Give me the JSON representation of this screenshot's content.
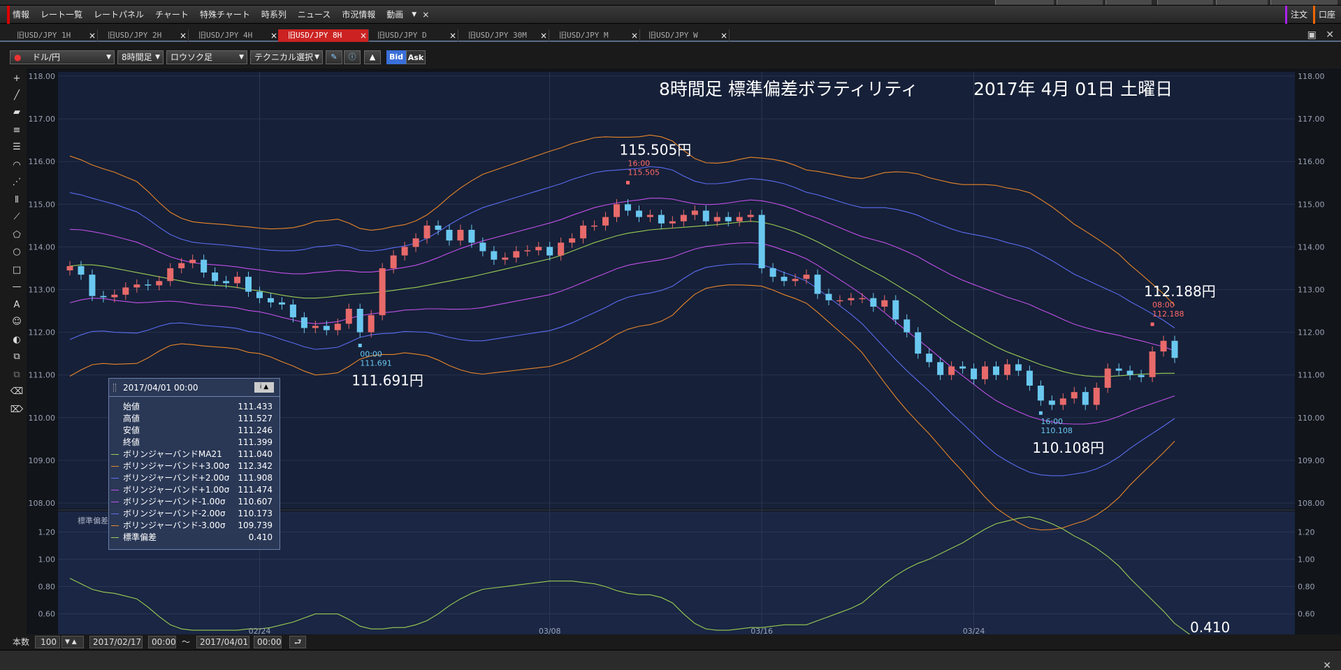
{
  "menu": {
    "items": [
      "情報",
      "レート一覧",
      "レートパネル",
      "チャート",
      "特殊チャート",
      "時系列",
      "ニュース",
      "市況情報",
      "動画"
    ],
    "more": "▼",
    "close": "×",
    "order_label": "注文",
    "account_label": "口座"
  },
  "tabs": [
    {
      "label": "旧USD/JPY 1H",
      "close": "×"
    },
    {
      "label": "旧USD/JPY 2H",
      "close": "×"
    },
    {
      "label": "旧USD/JPY 4H",
      "close": "×"
    },
    {
      "label": "旧USD/JPY 8H",
      "close": "×"
    },
    {
      "label": "旧USD/JPY D",
      "close": "×"
    },
    {
      "label": "旧USD/JPY 30M",
      "close": "×"
    },
    {
      "label": "旧USD/JPY M",
      "close": "×"
    },
    {
      "label": "旧USD/JPY W",
      "close": "×"
    }
  ],
  "active_tab": 3,
  "toolbar": {
    "currency": "ドル/円",
    "timeframe": "8時間足",
    "chart_type": "ロウソク足",
    "technical": "テクニカル選択",
    "bid": "Bid",
    "ask": "Ask"
  },
  "popup": {
    "datetime": "2017/04/01 00:00",
    "rows": [
      {
        "label": "始値",
        "value": "111.433",
        "color": ""
      },
      {
        "label": "高値",
        "value": "111.527",
        "color": ""
      },
      {
        "label": "安値",
        "value": "111.246",
        "color": ""
      },
      {
        "label": "終値",
        "value": "111.399",
        "color": ""
      },
      {
        "label": "ボリンジャーバンドMA21",
        "value": "111.040",
        "color": "#9acd54"
      },
      {
        "label": "ボリンジャーバンド+3.00σ",
        "value": "112.342",
        "color": "#e8862a"
      },
      {
        "label": "ボリンジャーバンド+2.00σ",
        "value": "111.908",
        "color": "#5a6cf0"
      },
      {
        "label": "ボリンジャーバンド+1.00σ",
        "value": "111.474",
        "color": "#c050e8"
      },
      {
        "label": "ボリンジャーバンド-1.00σ",
        "value": "110.607",
        "color": "#c050e8"
      },
      {
        "label": "ボリンジャーバンド-2.00σ",
        "value": "110.173",
        "color": "#5a6cf0"
      },
      {
        "label": "ボリンジャーバンド-3.00σ",
        "value": "109.739",
        "color": "#e8862a"
      },
      {
        "label": "標準偏差",
        "value": "0.410",
        "color": "#9acd54"
      }
    ]
  },
  "bottom": {
    "count_label": "本数",
    "count_value": "100",
    "from_date": "2017/02/17",
    "from_time": "00:00",
    "tilde": "～",
    "to_date": "2017/04/01",
    "to_time": "00:00"
  },
  "chart_data": {
    "type": "candlestick",
    "title": "8時間足 標準偏差ボラティリティ",
    "date_label": "2017年 4月 01日 土曜日",
    "main_y_ticks": [
      "118.00",
      "117.00",
      "116.00",
      "115.00",
      "114.00",
      "113.00",
      "112.00",
      "111.00",
      "110.00",
      "109.00",
      "108.00"
    ],
    "main_ylim": [
      108,
      118
    ],
    "sub_label": "標準偏差",
    "sub_y_ticks": [
      "1.20",
      "1.00",
      "0.80",
      "0.60"
    ],
    "sub_ylim": [
      0.45,
      1.35
    ],
    "x_ticks": [
      {
        "label": "02/24",
        "index": 17
      },
      {
        "label": "03/08",
        "index": 43
      },
      {
        "label": "03/16",
        "index": 62
      },
      {
        "label": "03/24",
        "index": 81
      }
    ],
    "n_bars": 100,
    "bar_up_color": "#e86a6a",
    "bar_down_color": "#6ac8f0",
    "annotations": [
      {
        "big": "115.505円",
        "time": "16:00",
        "value": "115.505",
        "index": 50,
        "price": 115.505,
        "kind": "high"
      },
      {
        "big": "111.691円",
        "time": "00:00",
        "value": "111.691",
        "index": 26,
        "price": 111.691,
        "kind": "low"
      },
      {
        "big": "110.108円",
        "time": "16:00",
        "value": "110.108",
        "index": 87,
        "price": 110.108,
        "kind": "low"
      },
      {
        "big": "112.188円",
        "time": "08:00",
        "value": "112.188",
        "index": 97,
        "price": 112.188,
        "kind": "high"
      }
    ],
    "last_stddev_label": "0.410",
    "closes": [
      113.55,
      113.35,
      112.85,
      112.82,
      112.88,
      113.05,
      113.12,
      113.1,
      113.2,
      113.5,
      113.62,
      113.7,
      113.4,
      113.2,
      113.15,
      113.3,
      112.95,
      112.8,
      112.7,
      112.65,
      112.35,
      112.1,
      112.15,
      112.05,
      112.2,
      112.55,
      112.0,
      112.4,
      113.5,
      113.8,
      114.0,
      114.2,
      114.5,
      114.4,
      114.15,
      114.4,
      114.1,
      113.9,
      113.7,
      113.75,
      113.9,
      113.92,
      114.0,
      113.8,
      114.1,
      114.2,
      114.5,
      114.5,
      114.7,
      115.0,
      114.85,
      114.7,
      114.75,
      114.55,
      114.6,
      114.75,
      114.85,
      114.6,
      114.7,
      114.6,
      114.7,
      114.75,
      113.5,
      113.3,
      113.2,
      113.25,
      113.35,
      112.9,
      112.75,
      112.75,
      112.8,
      112.8,
      112.6,
      112.75,
      112.3,
      112.0,
      111.5,
      111.3,
      111.0,
      111.2,
      111.15,
      110.9,
      111.2,
      111.0,
      111.25,
      111.1,
      110.75,
      110.4,
      110.3,
      110.45,
      110.6,
      110.3,
      110.7,
      111.15,
      111.1,
      111.0,
      110.95,
      111.55,
      111.8,
      111.4
    ],
    "opens": [
      113.45,
      113.55,
      113.35,
      112.85,
      112.82,
      112.88,
      113.05,
      113.12,
      113.1,
      113.2,
      113.5,
      113.62,
      113.7,
      113.4,
      113.2,
      113.15,
      113.3,
      112.95,
      112.8,
      112.7,
      112.65,
      112.35,
      112.1,
      112.15,
      112.05,
      112.2,
      112.55,
      112.0,
      112.4,
      113.5,
      113.8,
      114.0,
      114.2,
      114.5,
      114.4,
      114.15,
      114.4,
      114.1,
      113.9,
      113.7,
      113.75,
      113.9,
      113.92,
      114.0,
      113.8,
      114.1,
      114.2,
      114.5,
      114.5,
      114.7,
      115.0,
      114.85,
      114.7,
      114.75,
      114.55,
      114.6,
      114.75,
      114.85,
      114.6,
      114.7,
      114.6,
      114.7,
      114.75,
      113.5,
      113.3,
      113.2,
      113.25,
      113.35,
      112.9,
      112.75,
      112.75,
      112.8,
      112.8,
      112.6,
      112.75,
      112.3,
      112.0,
      111.5,
      111.3,
      111.0,
      111.2,
      111.15,
      110.9,
      111.2,
      111.0,
      111.25,
      111.1,
      110.75,
      110.4,
      110.3,
      110.45,
      110.6,
      110.3,
      110.7,
      111.15,
      111.1,
      111.0,
      110.95,
      111.55,
      111.8
    ],
    "ma21": [
      113.55,
      113.58,
      113.58,
      113.55,
      113.5,
      113.45,
      113.4,
      113.35,
      113.3,
      113.25,
      113.2,
      113.15,
      113.12,
      113.1,
      113.08,
      113.05,
      113.0,
      112.97,
      112.92,
      112.87,
      112.83,
      112.8,
      112.8,
      112.82,
      112.85,
      112.88,
      112.9,
      112.92,
      112.95,
      112.98,
      113.02,
      113.05,
      113.1,
      113.15,
      113.2,
      113.25,
      113.3,
      113.36,
      113.42,
      113.48,
      113.54,
      113.6,
      113.66,
      113.72,
      113.8,
      113.9,
      114.0,
      114.1,
      114.18,
      114.26,
      114.32,
      114.36,
      114.4,
      114.42,
      114.44,
      114.46,
      114.48,
      114.5,
      114.52,
      114.55,
      114.58,
      114.6,
      114.58,
      114.52,
      114.44,
      114.35,
      114.24,
      114.12,
      113.98,
      113.84,
      113.7,
      113.56,
      113.42,
      113.28,
      113.12,
      112.96,
      112.8,
      112.62,
      112.44,
      112.26,
      112.1,
      111.95,
      111.8,
      111.66,
      111.54,
      111.44,
      111.34,
      111.24,
      111.16,
      111.08,
      111.02,
      110.98,
      110.96,
      110.96,
      110.98,
      111.0,
      111.02,
      111.03,
      111.04,
      111.04
    ],
    "stddev": [
      0.86,
      0.82,
      0.78,
      0.76,
      0.75,
      0.73,
      0.71,
      0.65,
      0.58,
      0.52,
      0.49,
      0.48,
      0.48,
      0.48,
      0.48,
      0.48,
      0.49,
      0.49,
      0.5,
      0.52,
      0.54,
      0.57,
      0.6,
      0.6,
      0.6,
      0.56,
      0.51,
      0.49,
      0.49,
      0.5,
      0.5,
      0.52,
      0.55,
      0.6,
      0.66,
      0.71,
      0.75,
      0.78,
      0.79,
      0.8,
      0.81,
      0.82,
      0.83,
      0.84,
      0.84,
      0.84,
      0.83,
      0.82,
      0.8,
      0.77,
      0.75,
      0.74,
      0.74,
      0.72,
      0.68,
      0.6,
      0.53,
      0.49,
      0.48,
      0.48,
      0.49,
      0.5,
      0.5,
      0.51,
      0.52,
      0.52,
      0.52,
      0.55,
      0.58,
      0.61,
      0.64,
      0.68,
      0.75,
      0.82,
      0.88,
      0.93,
      0.97,
      1.0,
      1.04,
      1.08,
      1.12,
      1.17,
      1.22,
      1.26,
      1.28,
      1.3,
      1.31,
      1.29,
      1.26,
      1.22,
      1.17,
      1.13,
      1.08,
      1.02,
      0.95,
      0.86,
      0.78,
      0.7,
      0.62,
      0.53,
      0.47,
      0.41
    ]
  }
}
